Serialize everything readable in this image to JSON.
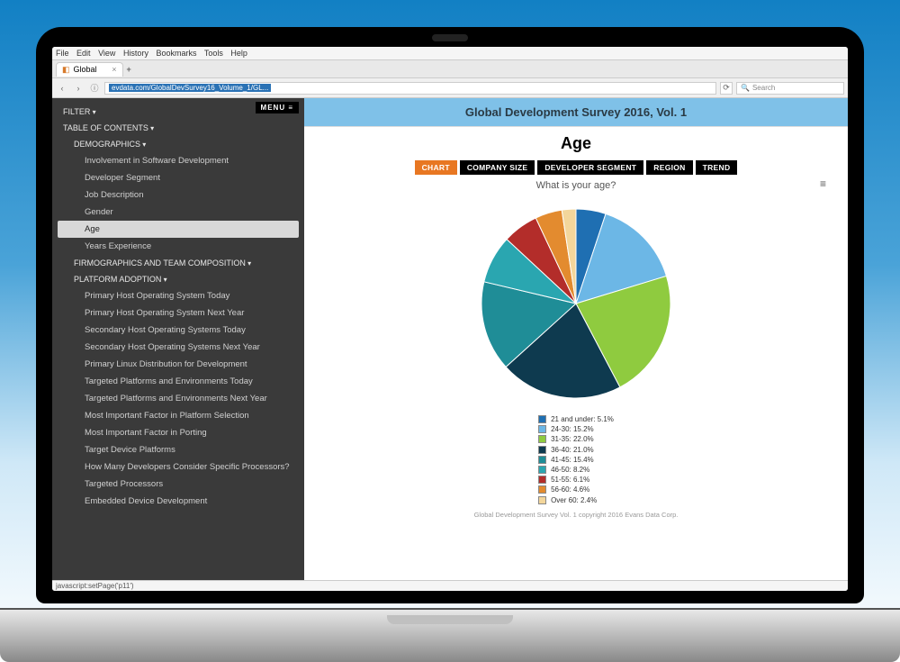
{
  "browser": {
    "menu": [
      "File",
      "Edit",
      "View",
      "History",
      "Bookmarks",
      "Tools",
      "Help"
    ],
    "tab_title": "Global",
    "url_text": "evdata.com/GlobalDevSurvey16_Volume_1/GL...",
    "search_placeholder": "Search",
    "status_text": "javascript:setPage('p11')"
  },
  "sidebar": {
    "menu_button": "MENU ≡",
    "filter": "FILTER",
    "toc": "TABLE OF CONTENTS",
    "sections": {
      "demographics": {
        "title": "DEMOGRAPHICS",
        "items": [
          "Involvement in Software Development",
          "Developer Segment",
          "Job Description",
          "Gender",
          "Age",
          "Years Experience"
        ],
        "selected_index": 4
      },
      "firmographics": {
        "title": "FIRMOGRAPHICS AND TEAM COMPOSITION"
      },
      "platform": {
        "title": "PLATFORM ADOPTION",
        "items": [
          "Primary Host Operating System Today",
          "Primary Host Operating System Next Year",
          "Secondary Host Operating Systems Today",
          "Secondary Host Operating Systems Next Year",
          "Primary Linux Distribution for Development",
          "Targeted Platforms and Environments Today",
          "Targeted Platforms and Environments Next Year",
          "Most Important Factor in Platform Selection",
          "Most Important Factor in Porting",
          "Target Device Platforms",
          "How Many Developers Consider Specific Processors?",
          "Targeted Processors",
          "Embedded Device Development"
        ]
      }
    }
  },
  "header": {
    "banner": "Global Development Survey 2016, Vol. 1",
    "page_title": "Age",
    "subquestion": "What is your age?",
    "tabs": [
      "CHART",
      "COMPANY SIZE",
      "DEVELOPER SEGMENT",
      "REGION",
      "TREND"
    ],
    "active_tab_index": 0,
    "footer": "Global Development Survey Vol. 1 copyright 2016 Evans Data Corp."
  },
  "chart_data": {
    "type": "pie",
    "title": "What is your age?",
    "series": [
      {
        "name": "21 and under",
        "value": 5.1,
        "label": "21 and under: 5.1%",
        "color": "#1f6fb2"
      },
      {
        "name": "24-30",
        "value": 15.2,
        "label": "24-30: 15.2%",
        "color": "#6cb7e6"
      },
      {
        "name": "31-35",
        "value": 22.0,
        "label": "31-35: 22.0%",
        "color": "#8fcb3f"
      },
      {
        "name": "36-40",
        "value": 21.0,
        "label": "36-40: 21.0%",
        "color": "#0e3a4f"
      },
      {
        "name": "41-45",
        "value": 15.4,
        "label": "41-45: 15.4%",
        "color": "#1f8d97"
      },
      {
        "name": "46-50",
        "value": 8.2,
        "label": "46-50: 8.2%",
        "color": "#2aa6b0"
      },
      {
        "name": "51-55",
        "value": 6.1,
        "label": "51-55: 6.1%",
        "color": "#b32d2a"
      },
      {
        "name": "56-60",
        "value": 4.6,
        "label": "56-60: 4.6%",
        "color": "#e38b2f"
      },
      {
        "name": "Over 60",
        "value": 2.4,
        "label": "Over 60: 2.4%",
        "color": "#f3d69b"
      }
    ]
  }
}
